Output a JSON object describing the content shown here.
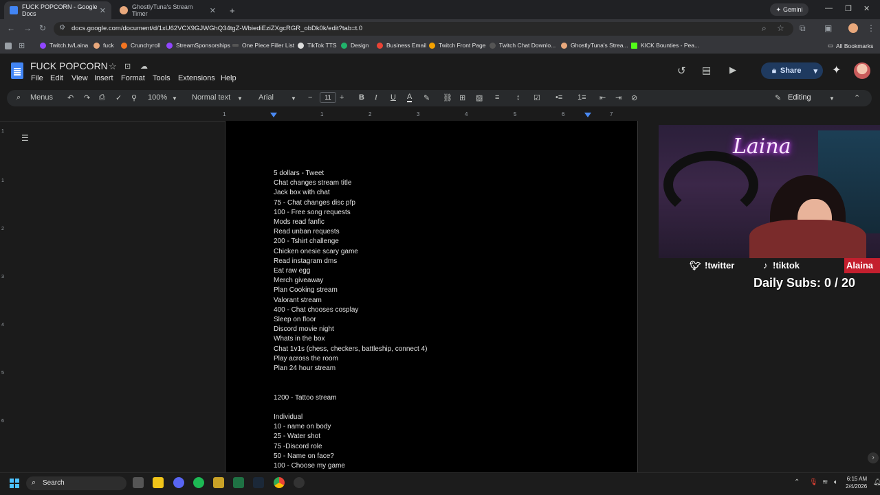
{
  "browser": {
    "tabs": [
      {
        "title": "FUCK POPCORN - Google Docs",
        "active": true,
        "color": "#4285f4"
      },
      {
        "title": "GhostlyTuna's Stream Timer",
        "active": false,
        "color": "#e8a87c"
      }
    ],
    "gemini_label": "Gemini",
    "url": "docs.google.com/document/d/1xU62VCX9GJWGhQ34tgZ-WbiediEziZXgcRGR_obDk0k/edit?tab=t.0",
    "bookmarks": [
      {
        "label": "Twitch.tv/Laina",
        "color": "#9146ff"
      },
      {
        "label": "fuck",
        "color": "#e8a87c"
      },
      {
        "label": "Crunchyroll",
        "color": "#f47521"
      },
      {
        "label": "StreamSponsorships",
        "color": "#9146ff"
      },
      {
        "label": "One Piece Filler List",
        "color": "#333"
      },
      {
        "label": "TikTok TTS",
        "color": "#ddd"
      },
      {
        "label": "Design",
        "color": "#21b36b"
      },
      {
        "label": "Business Email",
        "color": "#ea4335"
      },
      {
        "label": "Twitch Front Page",
        "color": "#f4a100"
      },
      {
        "label": "Twitch Chat Downlo...",
        "color": "#555"
      },
      {
        "label": "GhostlyTuna's Strea...",
        "color": "#e8a87c"
      },
      {
        "label": "KICK Bounties - Pea...",
        "color": "#53fc18"
      }
    ],
    "all_bookmarks_label": "All Bookmarks"
  },
  "docs": {
    "title": "FUCK POPCORN",
    "menu": [
      "File",
      "Edit",
      "View",
      "Insert",
      "Format",
      "Tools",
      "Extensions",
      "Help"
    ],
    "share_label": "Share",
    "toolbar": {
      "menus_label": "Menus",
      "zoom": "100%",
      "style": "Normal text",
      "font": "Arial",
      "font_size": "11",
      "mode": "Editing"
    },
    "ruler_numbers": [
      "1",
      "1",
      "2",
      "3",
      "4",
      "5",
      "6",
      "7"
    ],
    "vruler_numbers": [
      "1",
      "1",
      "2",
      "3",
      "4",
      "5",
      "6"
    ],
    "lines": [
      "5 dollars - Tweet",
      "Chat changes stream title",
      "Jack box with chat",
      "75 - Chat changes disc pfp",
      "100 - Free song requests",
      "Mods read fanfic",
      "Read unban requests",
      "200 - Tshirt challenge",
      "Chicken onesie scary game",
      "Read instagram dms",
      "Eat raw egg",
      "Merch giveaway",
      "Plan Cooking stream",
      "Valorant stream",
      "400 - Chat chooses cosplay",
      "Sleep on floor",
      "Discord movie night",
      "Whats in the box",
      "Chat 1v1s (chess, checkers, battleship, connect 4)",
      "Play across the room",
      "Plan 24 hour stream",
      "",
      "",
      "1200 - Tattoo stream",
      "",
      "Individual",
      "10 - name on body",
      "25 - Water shot",
      "75 -Discord role",
      "50 - Name on face?",
      "100 - Choose my game"
    ]
  },
  "stream": {
    "neon_sign": "Laina",
    "twitter": "!twitter",
    "tiktok": "!tiktok",
    "name_tag": "Alaina",
    "daily_subs": "Daily Subs: 0 / 20"
  },
  "taskbar": {
    "search_label": "Search",
    "time": "6:15 AM",
    "date": "2/4/2026"
  }
}
